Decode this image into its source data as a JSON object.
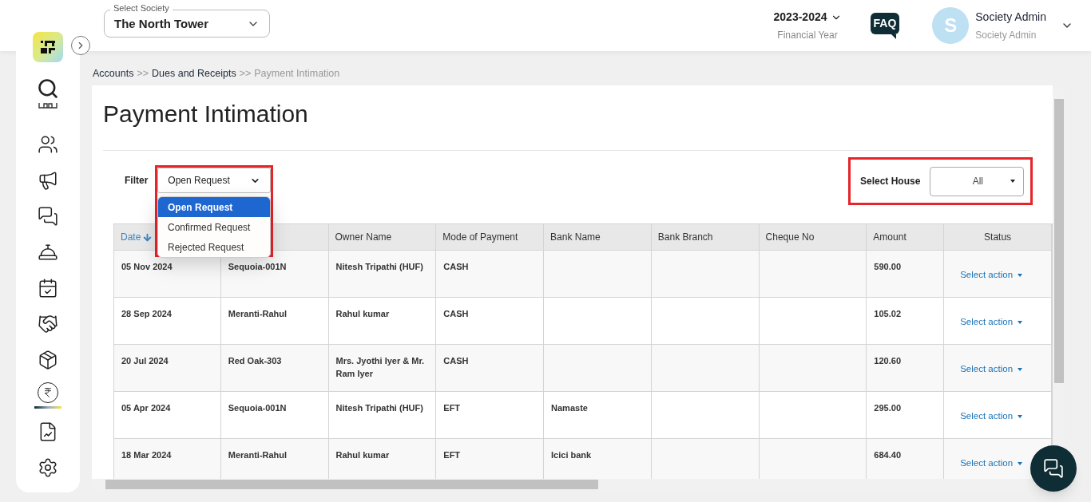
{
  "header": {
    "society_select": {
      "label": "Select Society",
      "value": "The North Tower"
    },
    "financial_year": {
      "value": "2023-2024",
      "label": "Financial Year"
    },
    "faq": "FAQ",
    "user": {
      "initial": "S",
      "name": "Society Admin",
      "role": "Society Admin"
    }
  },
  "sidebar": {
    "items": [
      {
        "selected": false
      },
      {
        "selected": false
      },
      {
        "selected": false
      },
      {
        "selected": false
      },
      {
        "selected": false
      },
      {
        "selected": false
      },
      {
        "selected": false
      },
      {
        "selected": false
      },
      {
        "selected": false
      },
      {
        "selected": true
      },
      {
        "selected": false
      },
      {
        "selected": false
      }
    ]
  },
  "breadcrumb": [
    {
      "label": "Accounts",
      "current": false
    },
    {
      "label": "Dues and Receipts",
      "current": false
    },
    {
      "label": "Payment Intimation",
      "current": true
    }
  ],
  "breadcrumb_separator": ">>",
  "page_title": "Payment Intimation",
  "filter": {
    "label": "Filter",
    "value": "Open Request",
    "expanded": true,
    "options": [
      {
        "label": "Open Request",
        "selected": true
      },
      {
        "label": "Confirmed Request",
        "selected": false
      },
      {
        "label": "Rejected Request",
        "selected": false
      }
    ]
  },
  "select_house": {
    "label": "Select House",
    "value": "All"
  },
  "table": {
    "columns": [
      {
        "label": "Date",
        "sorted": true
      },
      {
        "sorted": false
      },
      {
        "label": "Owner Name",
        "sorted": false
      },
      {
        "label": "Mode of Payment",
        "sorted": false
      },
      {
        "label": "Bank Name",
        "sorted": false
      },
      {
        "label": "Bank Branch",
        "sorted": false
      },
      {
        "label": "Cheque No",
        "sorted": false
      },
      {
        "label": "Amount",
        "sorted": false
      },
      {
        "label": "Status",
        "sorted": false
      }
    ],
    "rows": [
      {
        "date": "05 Nov 2024",
        "column_2": "Sequoia-001N",
        "owner_name": "Nitesh Tripathi (HUF)",
        "mode_of_payment": "CASH",
        "amount": "590.00",
        "status": "Select action"
      },
      {
        "date": "28 Sep 2024",
        "column_2": "Meranti-Rahul",
        "owner_name": "Rahul kumar",
        "mode_of_payment": "CASH",
        "amount": "105.02",
        "status": "Select action"
      },
      {
        "date": "20 Jul 2024",
        "column_2": "Red Oak-303",
        "owner_name": "Mrs. Jyothi Iyer & Mr. Ram Iyer",
        "mode_of_payment": "CASH",
        "amount": "120.60",
        "status": "Select action"
      },
      {
        "date": "05 Apr 2024",
        "column_2": "Sequoia-001N",
        "owner_name": "Nitesh Tripathi (HUF)",
        "mode_of_payment": "EFT",
        "bank_name": "Namaste",
        "amount": "295.00",
        "status": "Select action"
      },
      {
        "date": "18 Mar 2024",
        "column_2": "Meranti-Rahul",
        "owner_name": "Rahul kumar",
        "mode_of_payment": "EFT",
        "bank_name": "Icici bank",
        "amount": "684.40",
        "status": "Select action"
      }
    ]
  }
}
